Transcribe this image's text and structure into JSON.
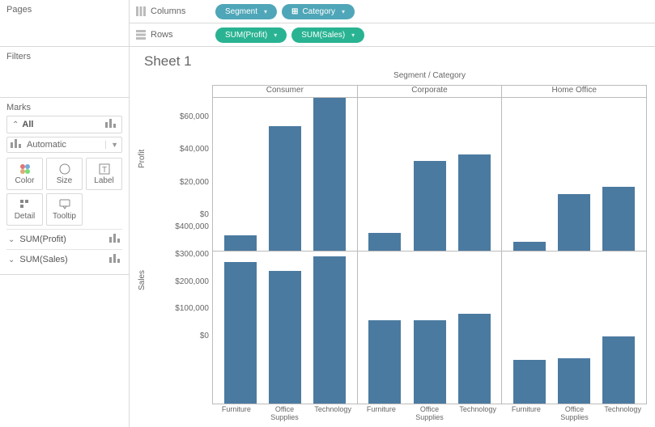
{
  "left": {
    "pages_title": "Pages",
    "filters_title": "Filters",
    "marks_title": "Marks",
    "marks_all": "All",
    "mark_type": "Automatic",
    "cells": {
      "color": "Color",
      "size": "Size",
      "label": "Label",
      "detail": "Detail",
      "tooltip": "Tooltip"
    },
    "sub1": "SUM(Profit)",
    "sub2": "SUM(Sales)"
  },
  "shelves": {
    "columns_label": "Columns",
    "rows_label": "Rows",
    "col_pills": [
      "Segment",
      "Category"
    ],
    "row_pills": [
      "SUM(Profit)",
      "SUM(Sales)"
    ]
  },
  "sheet": {
    "title": "Sheet 1",
    "super_label": "Segment / Category",
    "segments": [
      "Consumer",
      "Corporate",
      "Home Office"
    ],
    "categories": [
      "Furniture",
      "Office Supplies",
      "Technology"
    ],
    "profit_axis": "Profit",
    "sales_axis": "Sales",
    "profit_ticks": [
      "$60,000",
      "$40,000",
      "$20,000",
      "$0"
    ],
    "sales_ticks": [
      "$400,000",
      "$300,000",
      "$200,000",
      "$100,000",
      "$0"
    ]
  },
  "chart_data": {
    "type": "bar",
    "segments": [
      "Consumer",
      "Corporate",
      "Home Office"
    ],
    "categories": [
      "Furniture",
      "Office Supplies",
      "Technology"
    ],
    "series": [
      {
        "name": "Profit",
        "ylim": [
          0,
          70000
        ],
        "ylabel": "Profit",
        "values": {
          "Consumer": {
            "Furniture": 7000,
            "Office Supplies": 57000,
            "Technology": 70000
          },
          "Corporate": {
            "Furniture": 8000,
            "Office Supplies": 41000,
            "Technology": 44000
          },
          "Home Office": {
            "Furniture": 4000,
            "Office Supplies": 26000,
            "Technology": 29000
          }
        }
      },
      {
        "name": "Sales",
        "ylim": [
          0,
          420000
        ],
        "ylabel": "Sales",
        "values": {
          "Consumer": {
            "Furniture": 390000,
            "Office Supplies": 365000,
            "Technology": 405000
          },
          "Corporate": {
            "Furniture": 230000,
            "Office Supplies": 230000,
            "Technology": 248000
          },
          "Home Office": {
            "Furniture": 120000,
            "Office Supplies": 125000,
            "Technology": 185000
          }
        }
      }
    ]
  }
}
